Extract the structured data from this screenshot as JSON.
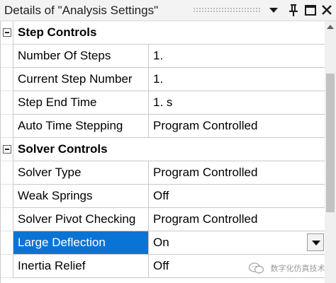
{
  "panel": {
    "title": "Details of \"Analysis Settings\"",
    "icons": [
      "dropdown-arrow-icon",
      "pin-icon",
      "maximize-icon",
      "close-icon"
    ]
  },
  "groups": [
    {
      "label": "Step Controls",
      "expanded": true,
      "rows": [
        {
          "name": "Number Of Steps",
          "value": "1."
        },
        {
          "name": "Current Step Number",
          "value": "1."
        },
        {
          "name": "Step End Time",
          "value": "1. s"
        },
        {
          "name": "Auto Time Stepping",
          "value": "Program Controlled"
        }
      ]
    },
    {
      "label": "Solver Controls",
      "expanded": true,
      "rows": [
        {
          "name": "Solver Type",
          "value": "Program Controlled"
        },
        {
          "name": "Weak Springs",
          "value": "Off"
        },
        {
          "name": "Solver Pivot Checking",
          "value": "Program Controlled"
        },
        {
          "name": "Large Deflection",
          "value": "On",
          "selected": true,
          "dropdown": true
        },
        {
          "name": "Inertia Relief",
          "value": "Off"
        }
      ]
    }
  ],
  "watermark": {
    "text": "数字化仿真技术"
  },
  "colors": {
    "selection": "#0a74d6",
    "grid_line": "#c9c9c9",
    "title_bg": "#f3f3f3"
  }
}
